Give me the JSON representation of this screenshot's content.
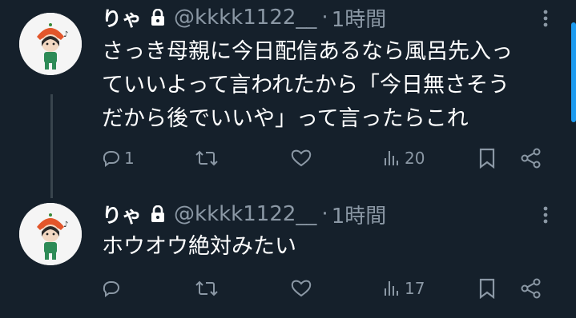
{
  "tweets": [
    {
      "display_name": "りゃ",
      "handle": "@kkkk1122__",
      "separator": "·",
      "time": "1時間",
      "text_lines": [
        "さっき母親に今日配信あるなら風呂先入っ",
        "ていいよって言われたから「今日無さそう",
        "だから後でいいや」って言ったらこれ"
      ],
      "reply_count": "1",
      "views_count": "20"
    },
    {
      "display_name": "りゃ",
      "handle": "@kkkk1122__",
      "separator": "·",
      "time": "1時間",
      "text_lines": [
        "ホウオウ絶対みたい"
      ],
      "reply_count": "",
      "views_count": "17"
    }
  ],
  "colors": {
    "background": "#15202b",
    "secondary_text": "#8b98a5",
    "accent": "#1d9bf0",
    "thread_line": "#38444d"
  },
  "icons": [
    "lock-icon",
    "more-icon",
    "reply-icon",
    "retweet-icon",
    "like-icon",
    "views-icon",
    "bookmark-icon",
    "share-icon"
  ]
}
